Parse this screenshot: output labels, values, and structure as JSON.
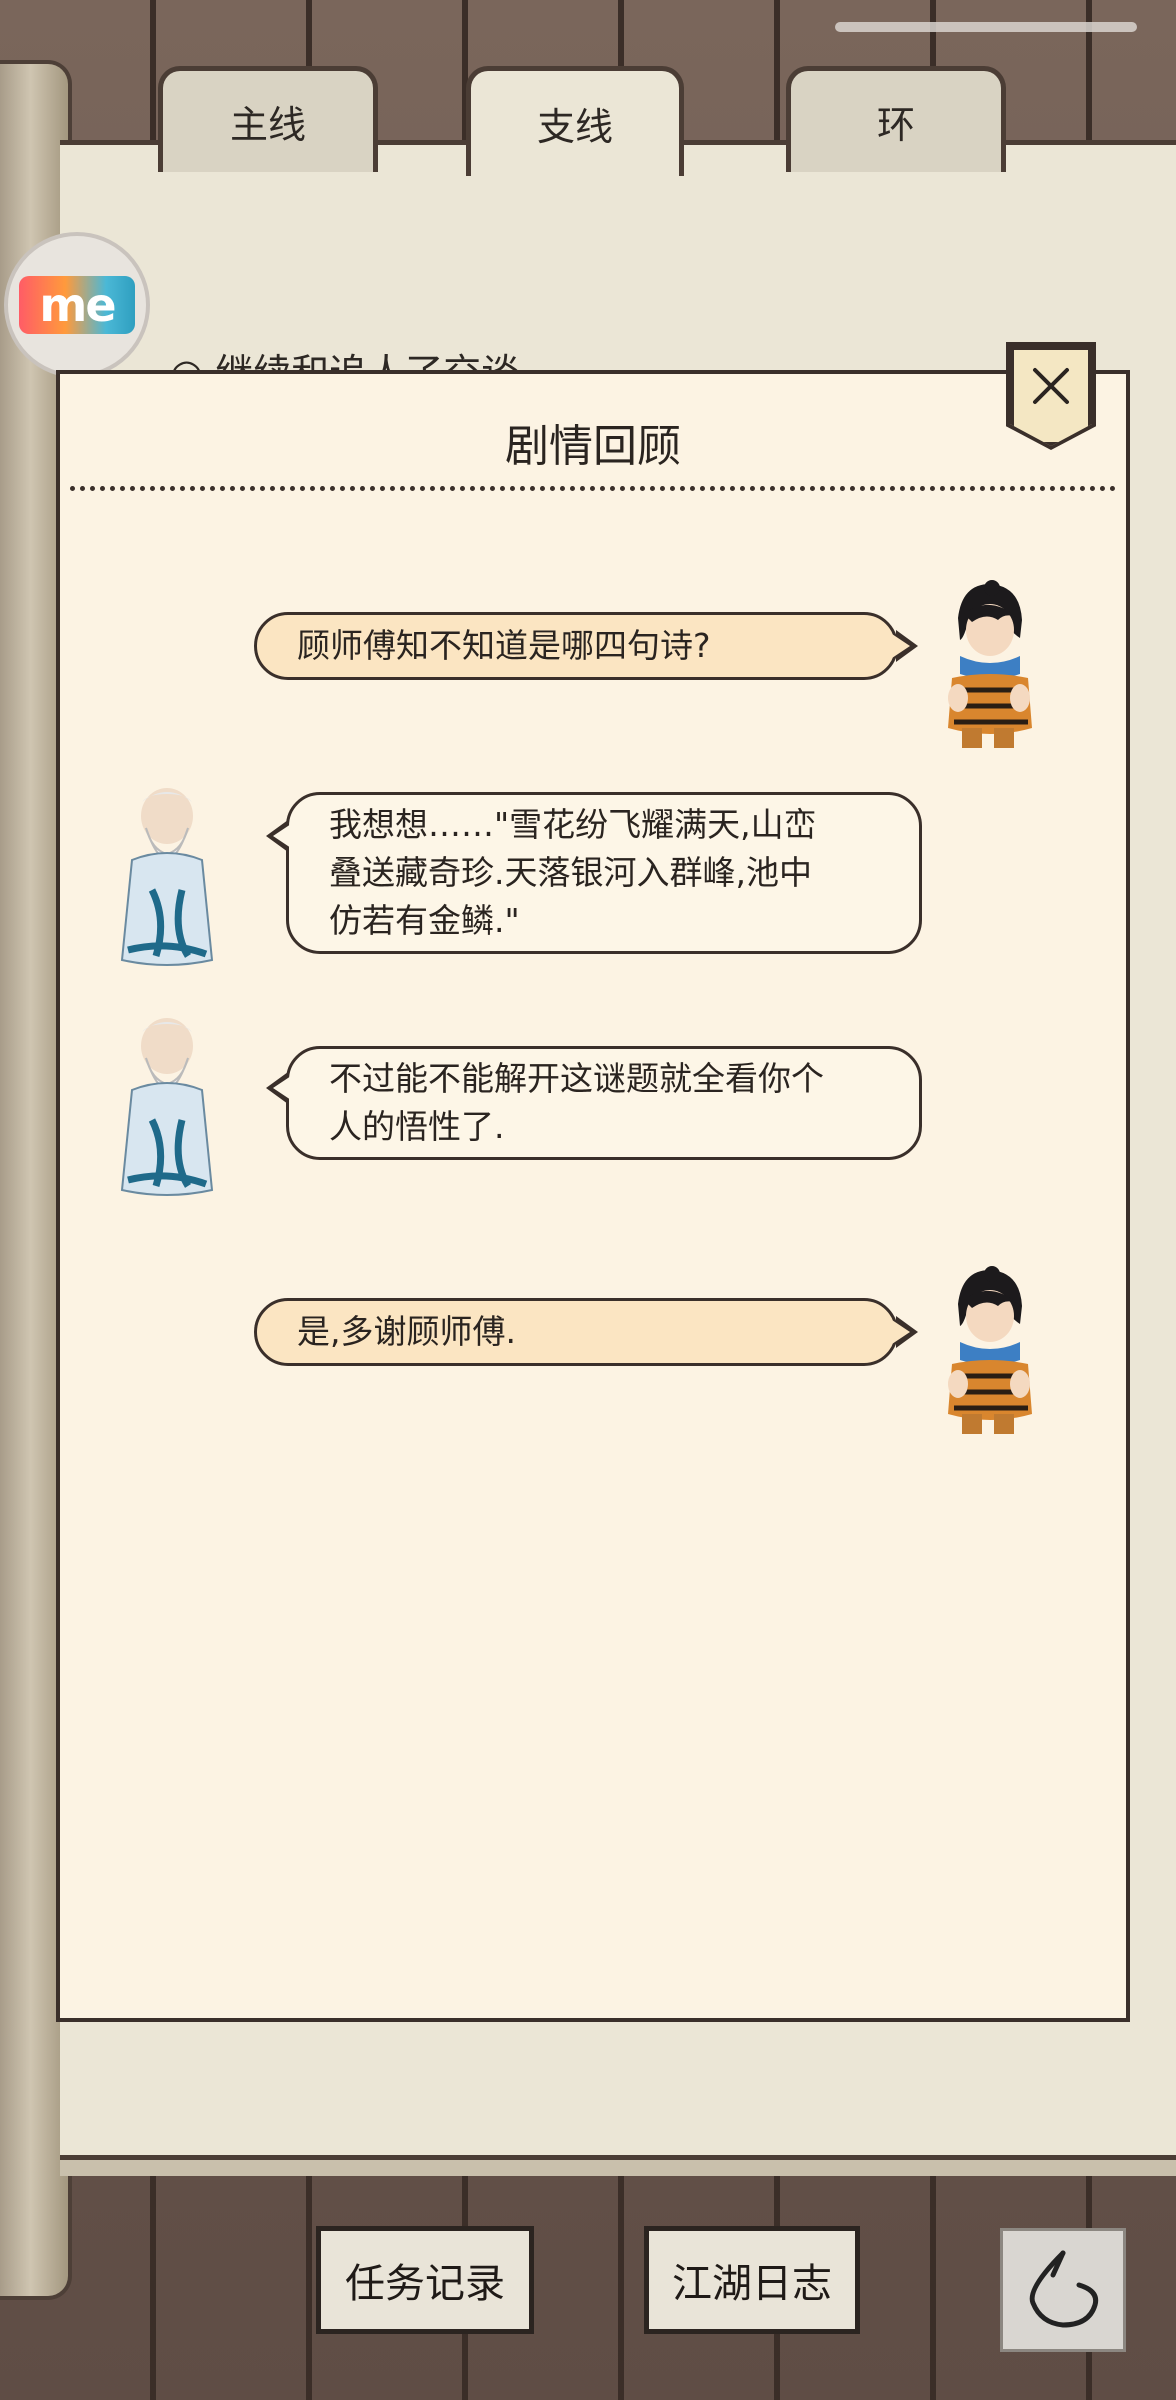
{
  "tabs": [
    {
      "label": "主线"
    },
    {
      "label": "支线"
    },
    {
      "label": "环"
    }
  ],
  "active_tab": "支线",
  "behind_task_text": "继续和追人了交谈",
  "me_logo_text": "me",
  "modal": {
    "title": "剧情回顾",
    "messages": [
      {
        "speaker": "hero",
        "side": "right",
        "text": "顾师傅知不知道是哪四句诗?"
      },
      {
        "speaker": "elder",
        "side": "left",
        "lines": [
          "我想想……\"雪花纷飞耀满天,山峦",
          "叠送藏奇珍.天落银河入群峰,池中",
          "仿若有金鳞.\""
        ]
      },
      {
        "speaker": "elder",
        "side": "left",
        "lines": [
          "不过能不能解开这谜题就全看你个",
          "人的悟性了."
        ]
      },
      {
        "speaker": "hero",
        "side": "right",
        "text": "是,多谢顾师傅."
      }
    ]
  },
  "bottom": {
    "task_record": "任务记录",
    "jianghu_log": "江湖日志"
  },
  "colors": {
    "parchment": "#ebe6d6",
    "modal_bg": "#fcf3e3",
    "bubble_right": "#fbe5c2",
    "border": "#3a2f2a"
  }
}
